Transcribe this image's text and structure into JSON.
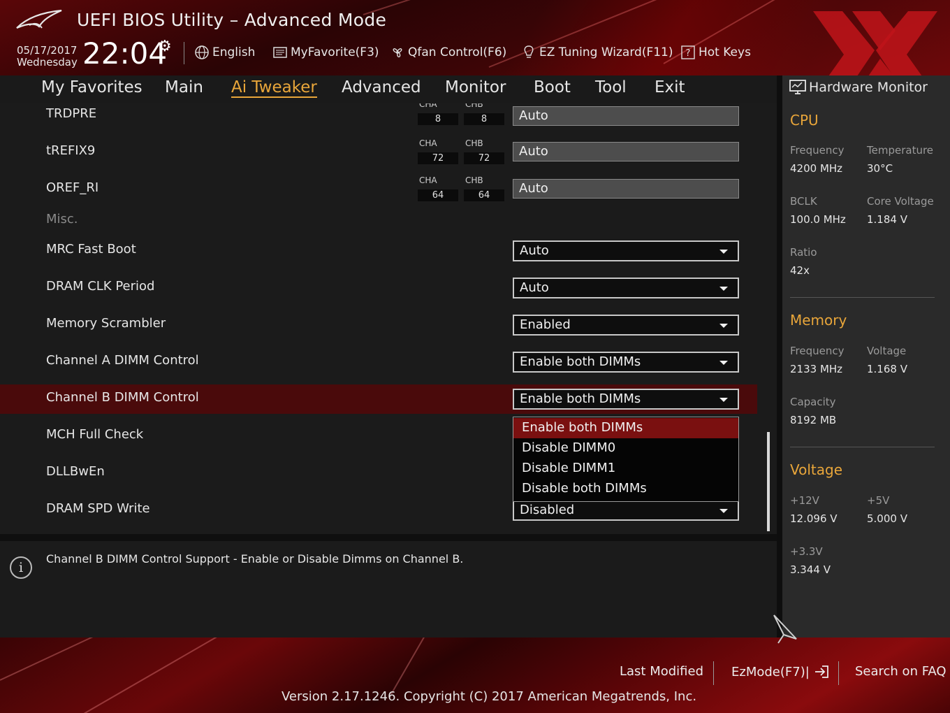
{
  "header": {
    "title": "UEFI BIOS Utility – Advanced Mode",
    "date": "05/17/2017",
    "weekday": "Wednesday",
    "time": "22:04",
    "toolbar": [
      {
        "label": "English",
        "icon": "globe-icon"
      },
      {
        "label": "MyFavorite(F3)",
        "icon": "favorite-list-icon"
      },
      {
        "label": "Qfan Control(F6)",
        "icon": "fan-icon"
      },
      {
        "label": "EZ Tuning Wizard(F11)",
        "icon": "lightbulb-icon"
      },
      {
        "label": "Hot Keys",
        "icon": "question-icon"
      }
    ]
  },
  "nav": {
    "tabs": [
      "My Favorites",
      "Main",
      "Ai Tweaker",
      "Advanced",
      "Monitor",
      "Boot",
      "Tool",
      "Exit"
    ],
    "active": "Ai Tweaker"
  },
  "settings": [
    {
      "label": "TRDPRE",
      "cha_label": "CHA",
      "chb_label": "CHB",
      "cha": "8",
      "chb": "8",
      "value": "Auto"
    },
    {
      "label": "tREFIX9",
      "cha_label": "CHA",
      "chb_label": "CHB",
      "cha": "72",
      "chb": "72",
      "value": "Auto"
    },
    {
      "label": "OREF_RI",
      "cha_label": "CHA",
      "chb_label": "CHB",
      "cha": "64",
      "chb": "64",
      "value": "Auto"
    },
    {
      "label": "Misc."
    },
    {
      "label": "MRC Fast Boot",
      "value": "Auto"
    },
    {
      "label": "DRAM CLK Period",
      "value": "Auto"
    },
    {
      "label": "Memory Scrambler",
      "value": "Enabled"
    },
    {
      "label": "Channel A DIMM Control",
      "value": "Enable both DIMMs"
    },
    {
      "label": "Channel B DIMM Control",
      "value": "Enable both DIMMs"
    },
    {
      "label": "MCH Full Check"
    },
    {
      "label": "DLLBwEn"
    },
    {
      "label": "DRAM SPD Write",
      "value": "Disabled"
    }
  ],
  "dropdown": {
    "options": [
      "Enable both DIMMs",
      "Disable DIMM0",
      "Disable DIMM1",
      "Disable both DIMMs"
    ],
    "highlighted": "Enable both DIMMs"
  },
  "info": {
    "text": "Channel B DIMM Control Support - Enable or Disable Dimms on Channel B."
  },
  "hardware_monitor": {
    "title": "Hardware Monitor",
    "cpu": {
      "heading": "CPU",
      "frequency_label": "Frequency",
      "frequency": "4200 MHz",
      "temperature_label": "Temperature",
      "temperature": "30°C",
      "bclk_label": "BCLK",
      "bclk": "100.0 MHz",
      "core_voltage_label": "Core Voltage",
      "core_voltage": "1.184 V",
      "ratio_label": "Ratio",
      "ratio": "42x"
    },
    "memory": {
      "heading": "Memory",
      "frequency_label": "Frequency",
      "frequency": "2133 MHz",
      "voltage_label": "Voltage",
      "voltage": "1.168 V",
      "capacity_label": "Capacity",
      "capacity": "8192 MB"
    },
    "voltage": {
      "heading": "Voltage",
      "v12_label": "+12V",
      "v12": "12.096 V",
      "v5_label": "+5V",
      "v5": "5.000 V",
      "v33_label": "+3.3V",
      "v33": "3.344 V"
    }
  },
  "footer": {
    "last_modified": "Last Modified",
    "ezmode": "EzMode(F7)|",
    "search": "Search on FAQ",
    "version": "Version 2.17.1246. Copyright (C) 2017 American Megatrends, Inc."
  },
  "colors": {
    "accent": "#e9a63a",
    "selected_row": "#4a0a0b",
    "dropdown_highlight": "#7a1010",
    "brand_red": "#c0141a"
  }
}
